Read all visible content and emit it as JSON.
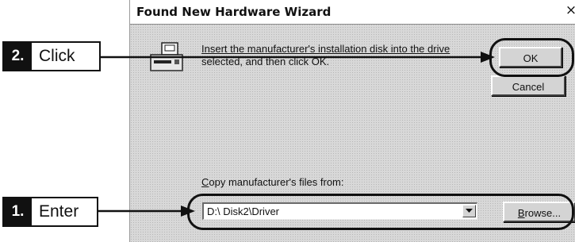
{
  "dialog": {
    "title": "Found New Hardware Wizard",
    "close_label": "×",
    "message_line1": "Insert the manufacturer's installation disk into the drive",
    "message_line2": "selected, and then click OK.",
    "ok_label": "OK",
    "cancel_label": "Cancel",
    "copy_label": "Copy manufacturer's files from:",
    "copy_label_accel": "C",
    "copy_label_rest": "opy manufacturer's files from:",
    "path_value": "D:\\ Disk2\\Driver",
    "browse_accel": "B",
    "browse_rest": "rowse...",
    "icon": "disk-drive-icon"
  },
  "callouts": {
    "click": {
      "number": "2.",
      "text": "Click"
    },
    "enter": {
      "number": "1.",
      "text": "Enter"
    }
  }
}
